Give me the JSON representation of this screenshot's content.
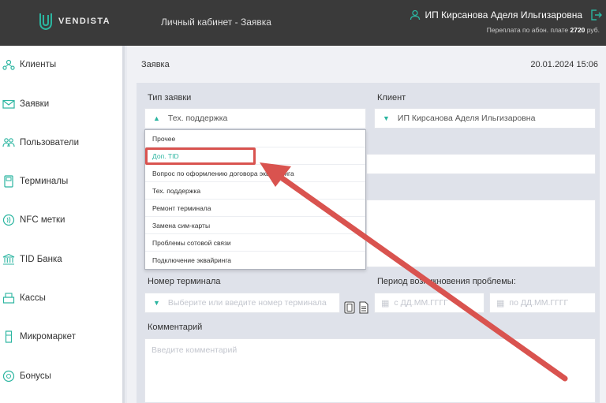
{
  "header": {
    "logo_text": "VENDISTA",
    "title": "Личный кабинет - Заявка",
    "user_name": "ИП Кирсанова Аделя Ильгизаровна",
    "balance_prefix": "Переплата по абон. плате",
    "balance_value": "2720",
    "balance_suffix": "руб."
  },
  "sidebar": {
    "items": [
      {
        "label": "Клиенты",
        "icon": "clients-icon"
      },
      {
        "label": "Заявки",
        "icon": "requests-icon"
      },
      {
        "label": "Пользователи",
        "icon": "users-icon"
      },
      {
        "label": "Терминалы",
        "icon": "terminal-icon"
      },
      {
        "label": "NFC метки",
        "icon": "nfc-icon"
      },
      {
        "label": "TID Банка",
        "icon": "bank-icon"
      },
      {
        "label": "Кассы",
        "icon": "cashbox-icon"
      },
      {
        "label": "Микромаркет",
        "icon": "micromarket-icon"
      },
      {
        "label": "Бонусы",
        "icon": "bonus-icon"
      }
    ]
  },
  "page": {
    "title": "Заявка",
    "date": "20.01.2024 15:06"
  },
  "form": {
    "request_type_label": "Тип заявки",
    "request_type_value": "Тех. поддержка",
    "client_label": "Клиент",
    "client_value": "ИП Кирсанова Аделя Ильгизаровна",
    "terminal_label": "Номер терминала",
    "terminal_placeholder": "Выберите или введите номер терминала",
    "period_label": "Период возникновения проблемы:",
    "date_from_placeholder": "с ДД.ММ.ГГГГ",
    "date_to_placeholder": "по ДД.ММ.ГГГГ",
    "comment_label": "Комментарий",
    "comment_placeholder": "Введите комментарий"
  },
  "dropdown": {
    "options": [
      "Прочее",
      "Доп. TID",
      "Вопрос по оформлению договора эквайринга",
      "Тех. поддержка",
      "Ремонт терминала",
      "Замена сим-карты",
      "Проблемы сотовой связи",
      "Подключение эквайринга"
    ],
    "highlighted_index": 1
  },
  "colors": {
    "accent": "#2bb5a0",
    "header_bg": "#3a3a3a",
    "annotation_red": "#d9534f"
  }
}
